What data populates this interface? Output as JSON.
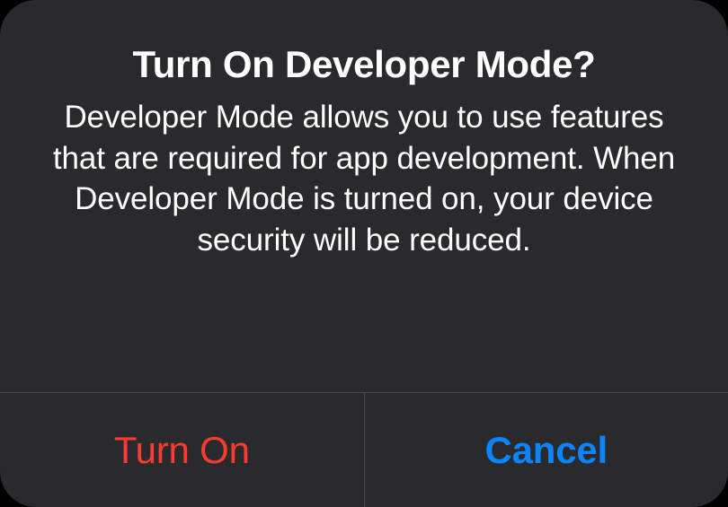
{
  "alert": {
    "title": "Turn On Developer Mode?",
    "message": "Developer Mode allows you to use features that are required for app development. When Developer Mode is turned on, your device security will be reduced.",
    "buttons": {
      "confirm": "Turn On",
      "cancel": "Cancel"
    }
  },
  "colors": {
    "destructive": "#ff3b30",
    "accent": "#0a84ff",
    "background": "#2a2a2c",
    "separator": "#4a4a4c",
    "text": "#ffffff"
  }
}
